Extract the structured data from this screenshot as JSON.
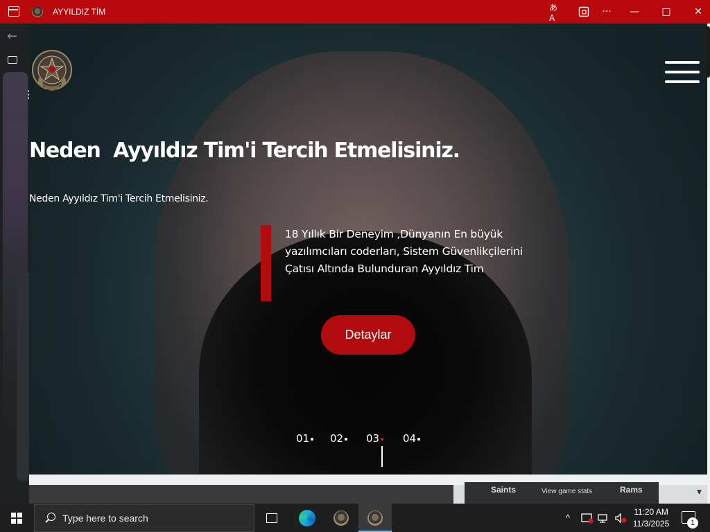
{
  "window": {
    "title": "AYYILDIZ TİM",
    "controls": {
      "translate_icon": "あA",
      "minimize": "—",
      "maximize": "□",
      "close": "✕",
      "more": "···"
    }
  },
  "hero": {
    "title": "Neden  Ayyıldız Tim'i Tercih Etmelisiniz.",
    "subtitle": "Neden Ayyıldız Tim'i Tercih Etmelisiniz.",
    "quote": "18 Yıllık Bir Deneyim ,Dünyanın En büyük yazılımcıları coderları, Sistem Güvenlikçilerini Çatısı Altında Bulunduran Ayyıldız Tim",
    "button_label": "Detaylar",
    "slides": [
      "01",
      "02",
      "03",
      "04"
    ],
    "active_slide": "03"
  },
  "behind_window": {
    "team_left": "Saints",
    "stats_link": "View game stats",
    "team_right": "Rams"
  },
  "taskbar": {
    "search_placeholder": "Type here to search",
    "time": "11:20 AM",
    "date": "11/3/2025",
    "notification_count": "1"
  },
  "colors": {
    "accent": "#b8080c",
    "button": "#b10b0d",
    "active_dot": "#d21a1d"
  }
}
